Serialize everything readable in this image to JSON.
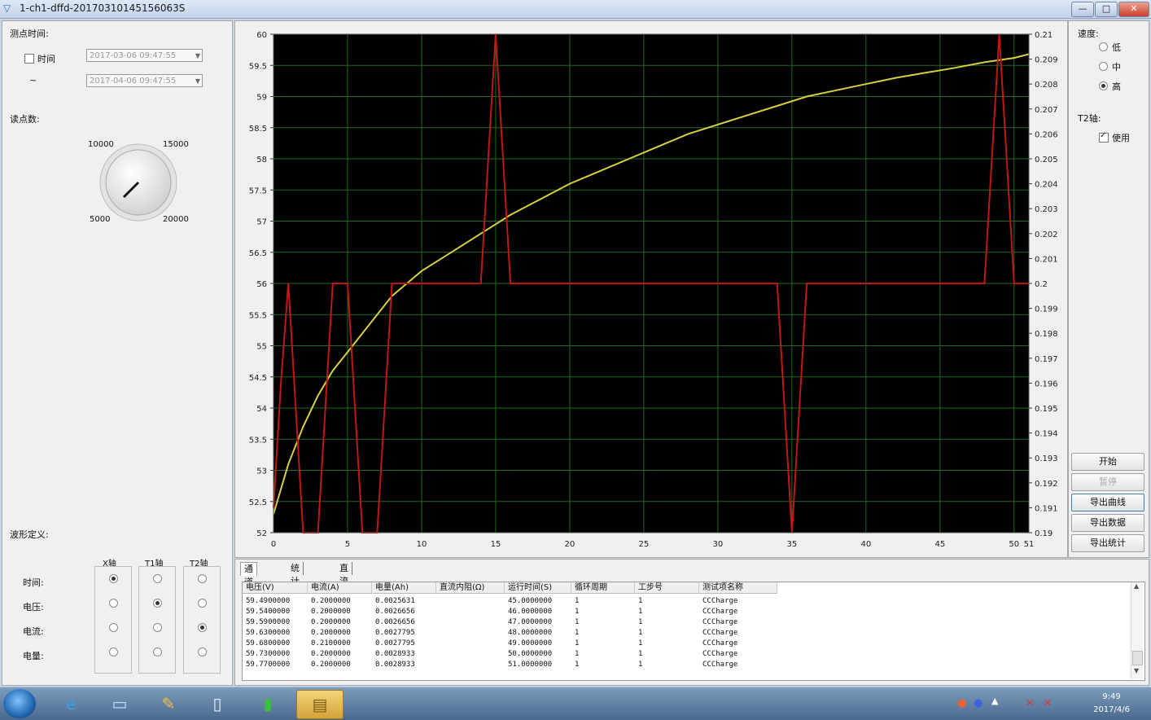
{
  "window": {
    "title": "1-ch1-dffd-20170310145156063S",
    "min": "—",
    "max": "□",
    "close": "✕"
  },
  "left": {
    "time_section_label": "测点时间:",
    "time_checkbox_label": "时间",
    "time_checked": false,
    "tilde": "~",
    "start_time": "2017-03-06 09:47:55",
    "end_time": "2017-04-06 09:47:55",
    "points_label": "读点数:",
    "knob": {
      "t1": "10000",
      "t2": "15000",
      "b1": "5000",
      "b2": "20000"
    },
    "wave_label": "波形定义:",
    "col_headers": [
      "X轴",
      "T1轴",
      "T2轴"
    ],
    "row_labels": [
      "时间:",
      "电压:",
      "电流:",
      "电量:"
    ],
    "selection": {
      "x": 0,
      "t1": 1,
      "t2": 2
    }
  },
  "right": {
    "speed_label": "速度:",
    "speed_options": [
      "低",
      "中",
      "高"
    ],
    "speed_selected": 2,
    "t2_label": "T2轴:",
    "t2_use_label": "使用",
    "t2_use_checked": true,
    "buttons": [
      {
        "label": "开始",
        "state": "normal"
      },
      {
        "label": "暂停",
        "state": "disabled"
      },
      {
        "label": "导出曲线",
        "state": "focused"
      },
      {
        "label": "导出数据",
        "state": "normal"
      },
      {
        "label": "导出统计",
        "state": "normal"
      }
    ]
  },
  "chart_data": {
    "type": "line",
    "background": "#000000",
    "grid": true,
    "grid_color": "#1f6b1f",
    "x_ticks": [
      "0",
      "5",
      "10",
      "15",
      "20",
      "25",
      "30",
      "35",
      "40",
      "45",
      "50",
      "51"
    ],
    "xlim": [
      0,
      51
    ],
    "left_ticks": [
      "60",
      "59.5",
      "59",
      "58.5",
      "58",
      "57.5",
      "57",
      "56.5",
      "56",
      "55.5",
      "55",
      "54.5",
      "54",
      "53.5",
      "53",
      "52.5",
      "52"
    ],
    "ylim_left": [
      52,
      60
    ],
    "right_ticks": [
      "0.21",
      "0.209",
      "0.208",
      "0.207",
      "0.206",
      "0.205",
      "0.204",
      "0.203",
      "0.202",
      "0.201",
      "0.2",
      "0.199",
      "0.198",
      "0.197",
      "0.196",
      "0.195",
      "0.194",
      "0.193",
      "0.192",
      "0.191",
      "0.19"
    ],
    "ylim_right": [
      0.19,
      0.21
    ],
    "series": [
      {
        "axis": "left",
        "color": "#d8d040",
        "x": [
          0,
          1,
          2,
          3,
          4,
          5,
          6,
          7,
          8,
          9,
          10,
          12,
          14,
          16,
          18,
          20,
          22,
          24,
          26,
          28,
          30,
          32,
          34,
          36,
          38,
          40,
          42,
          44,
          46,
          48,
          50,
          51
        ],
        "y": [
          52.3,
          53.1,
          53.7,
          54.2,
          54.6,
          54.9,
          55.2,
          55.5,
          55.8,
          56.0,
          56.2,
          56.5,
          56.8,
          57.1,
          57.35,
          57.6,
          57.8,
          58.0,
          58.2,
          58.4,
          58.55,
          58.7,
          58.85,
          59.0,
          59.1,
          59.2,
          59.3,
          59.38,
          59.46,
          59.55,
          59.62,
          59.68
        ]
      },
      {
        "axis": "right",
        "color": "#c01818",
        "x": [
          0,
          0.5,
          1,
          1.5,
          2,
          3,
          3.5,
          4,
          5,
          5.5,
          6,
          7,
          7.5,
          8,
          9,
          10,
          11,
          12,
          13,
          14,
          14.5,
          15,
          15.5,
          16,
          20,
          30,
          34,
          34.5,
          35,
          35.5,
          36,
          40,
          45,
          48,
          48.5,
          49,
          49.5,
          50,
          51
        ],
        "y": [
          0.191,
          0.196,
          0.2,
          0.195,
          0.19,
          0.19,
          0.195,
          0.2,
          0.2,
          0.195,
          0.19,
          0.19,
          0.195,
          0.2,
          0.2,
          0.2,
          0.2,
          0.2,
          0.2,
          0.2,
          0.205,
          0.21,
          0.205,
          0.2,
          0.2,
          0.2,
          0.2,
          0.195,
          0.19,
          0.195,
          0.2,
          0.2,
          0.2,
          0.2,
          0.205,
          0.21,
          0.205,
          0.2,
          0.2
        ]
      }
    ]
  },
  "tabs": [
    "通道数据",
    "统计数据",
    "直流内阻"
  ],
  "table": {
    "headers": [
      "电压(V)",
      "电流(A)",
      "电量(Ah)",
      "直流内阻(Ω)",
      "运行时间(S)",
      "循环周期",
      "工步号",
      "测试项名称"
    ],
    "rows": [
      [
        "59.4900000",
        "0.2000000",
        "0.0025631",
        "",
        "45.0000000",
        "1",
        "1",
        "CCCharge"
      ],
      [
        "59.5400000",
        "0.2000000",
        "0.0026656",
        "",
        "46.0000000",
        "1",
        "1",
        "CCCharge"
      ],
      [
        "59.5900000",
        "0.2000000",
        "0.0026656",
        "",
        "47.0000000",
        "1",
        "1",
        "CCCharge"
      ],
      [
        "59.6300000",
        "0.2000000",
        "0.0027795",
        "",
        "48.0000000",
        "1",
        "1",
        "CCCharge"
      ],
      [
        "59.6800000",
        "0.2100000",
        "0.0027795",
        "",
        "49.0000000",
        "1",
        "1",
        "CCCharge"
      ],
      [
        "59.7300000",
        "0.2000000",
        "0.0028933",
        "",
        "50.0000000",
        "1",
        "1",
        "CCCharge"
      ],
      [
        "59.7700000",
        "0.2000000",
        "0.0028933",
        "",
        "51.0000000",
        "1",
        "1",
        "CCCharge"
      ]
    ]
  },
  "taskbar": {
    "clock_time": "9:49",
    "clock_date": "2017/4/6",
    "items": [
      "ie-icon",
      "computer-icon",
      "paint-icon",
      "document-icon",
      "battery-app-icon",
      "explorer-icon"
    ]
  }
}
